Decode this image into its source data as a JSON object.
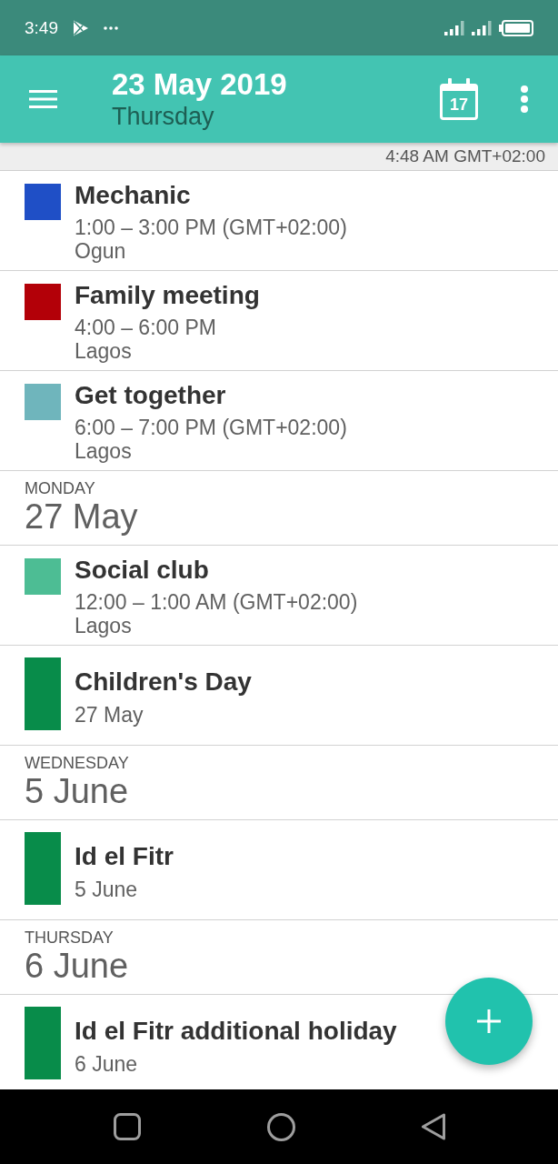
{
  "status_bar": {
    "time": "3:49"
  },
  "app_bar": {
    "title": "23 May 2019",
    "subtitle": "Thursday",
    "today_day": "17"
  },
  "timezone_strip": {
    "text": "4:48 AM GMT+02:00"
  },
  "agenda": [
    {
      "events": [
        {
          "kind": "timed",
          "title": "Mechanic",
          "time": "1:00 – 3:00 PM (GMT+02:00)",
          "location": "Ogun",
          "color": "#1f4fc6"
        },
        {
          "kind": "timed",
          "title": "Family meeting",
          "time": "4:00 – 6:00 PM",
          "location": "Lagos",
          "color": "#b30008"
        },
        {
          "kind": "timed",
          "title": "Get together",
          "time": "6:00 – 7:00 PM (GMT+02:00)",
          "location": "Lagos",
          "color": "#6fb5bc"
        }
      ]
    },
    {
      "weekday": "MONDAY",
      "date": "27 May",
      "events": [
        {
          "kind": "timed",
          "title": "Social club",
          "time": "12:00 – 1:00 AM (GMT+02:00)",
          "location": "Lagos",
          "color": "#4dbd94"
        },
        {
          "kind": "all_day",
          "title": "Children's Day",
          "date": "27 May",
          "color": "#088c4a"
        }
      ]
    },
    {
      "weekday": "WEDNESDAY",
      "date": "5 June",
      "events": [
        {
          "kind": "all_day",
          "title": "Id el Fitr",
          "date": "5 June",
          "color": "#088c4a"
        }
      ]
    },
    {
      "weekday": "THURSDAY",
      "date": "6 June",
      "events": [
        {
          "kind": "all_day",
          "title": "Id el Fitr additional holiday",
          "date": "6 June",
          "color": "#088c4a"
        }
      ]
    }
  ]
}
